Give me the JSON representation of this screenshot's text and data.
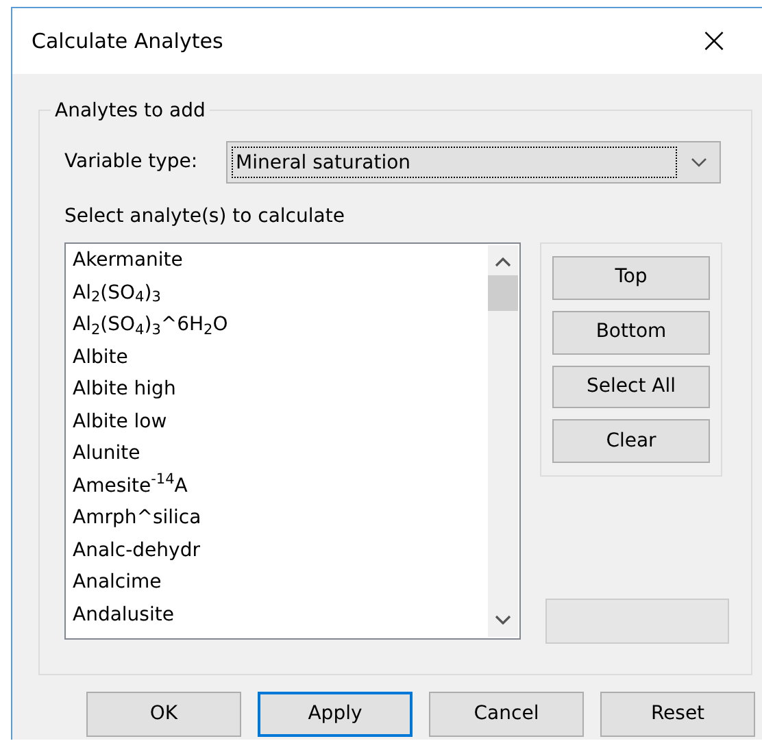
{
  "window": {
    "title": "Calculate Analytes",
    "close": "×"
  },
  "group": {
    "title": "Analytes to add",
    "variable_type": {
      "label": "Variable type:",
      "value": "Mineral saturation",
      "focused": true
    },
    "list_label": "Select analyte(s) to calculate",
    "analytes": [
      {
        "text": "Akermanite"
      },
      {
        "text": "Al$_{2}$(SO$_{4}$)$_{3}$"
      },
      {
        "text": "Al$_{2}$(SO$_{4}$)$_{3}$^6H$_{2}$O"
      },
      {
        "text": "Albite"
      },
      {
        "text": "Albite high"
      },
      {
        "text": "Albite low"
      },
      {
        "text": "Alunite"
      },
      {
        "text": "Amesite$^{-14}$A"
      },
      {
        "text": "Amrph^silica"
      },
      {
        "text": "Analc-dehydr"
      },
      {
        "text": "Analcime"
      },
      {
        "text": "Andalusite"
      }
    ],
    "side_buttons": [
      "Top",
      "Bottom",
      "Select All",
      "Clear"
    ],
    "blank_button": {
      "disabled": true
    }
  },
  "buttons": [
    {
      "label": "OK",
      "default": false
    },
    {
      "label": "Apply",
      "default": true
    },
    {
      "label": "Cancel",
      "default": false
    },
    {
      "label": "Reset",
      "default": false
    }
  ]
}
